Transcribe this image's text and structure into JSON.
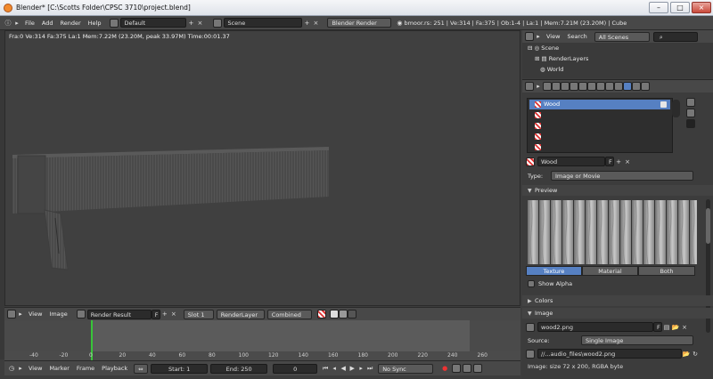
{
  "window": {
    "title": "Blender* [C:\\Scotts Folder\\CPSC 3710\\project.blend]",
    "buttons": [
      "–",
      "□",
      "×"
    ]
  },
  "infobar": {
    "menus": [
      "File",
      "Add",
      "Render",
      "Help"
    ],
    "layout": "Default",
    "scene": "Scene",
    "engine": "Blender Render",
    "stats": "bmoor.rs: 251 | Ve:314 | Fa:375 | Ob:1-4 | La:1 | Mem:7.21M (23.20M) | Cube"
  },
  "viewport": {
    "render_info": "Fra:0  Ve:314 Fa:375 La:1 Mem:7.22M (23.20M, peak 33.97M) Time:00:01.37"
  },
  "image_editor": {
    "menus": [
      "View",
      "Image"
    ],
    "image": "Render Result",
    "flag": "F",
    "slot": "Slot 1",
    "layer": "RenderLayer",
    "pass": "Combined"
  },
  "timeline": {
    "ticks": [
      "-40",
      "-20",
      "0",
      "20",
      "40",
      "60",
      "80",
      "100",
      "120",
      "140",
      "160",
      "180",
      "200",
      "220",
      "240",
      "260"
    ],
    "menus": [
      "View",
      "Marker",
      "Frame",
      "Playback"
    ],
    "start": "Start: 1",
    "end": "End: 250",
    "current": "0",
    "sync": "No Sync"
  },
  "outliner": {
    "menus": [
      "View",
      "Search"
    ],
    "filter": "All Scenes",
    "items": [
      "Scene",
      "RenderLayers",
      "World"
    ]
  },
  "properties": {
    "slots": [
      "Wood",
      "",
      "",
      "",
      ""
    ],
    "texture_name": "Wood",
    "texture_flag": "F",
    "type_label": "Type:",
    "type_value": "Image or Movie",
    "preview_label": "Preview",
    "tabs": [
      "Texture",
      "Material",
      "Both"
    ],
    "show_alpha": "Show Alpha",
    "colors_label": "Colors",
    "image_label": "Image",
    "image_file": "wood2.png",
    "image_flag": "F",
    "source_label": "Source:",
    "source_value": "Single Image",
    "filepath": "//...audio_files\\wood2.png",
    "image_info": "Image: size 72 x 200, RGBA byte"
  },
  "colors": {
    "accent": "#5680c2",
    "timeline_cursor": "#39c43a",
    "background": "#3d3d3d"
  }
}
